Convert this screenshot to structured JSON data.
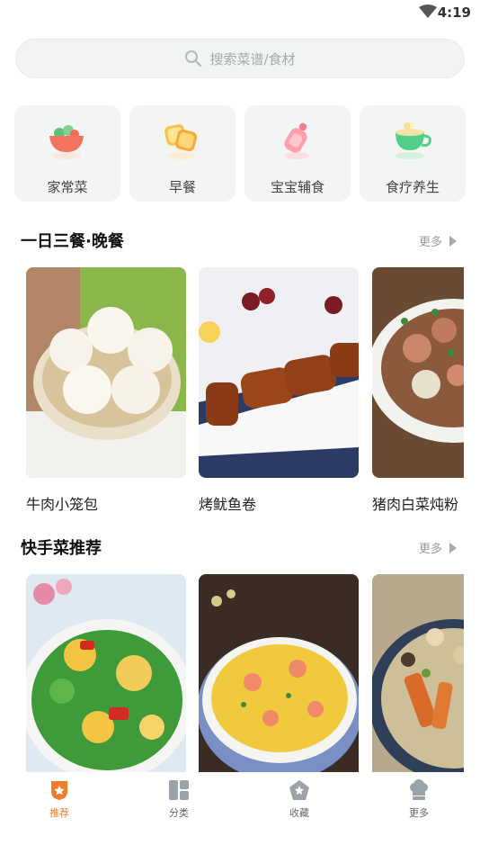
{
  "status": {
    "time": "4:19"
  },
  "search": {
    "placeholder": "搜索菜谱/食材"
  },
  "categories": [
    {
      "label": "家常菜",
      "icon": "bowl-icon"
    },
    {
      "label": "早餐",
      "icon": "toast-icon"
    },
    {
      "label": "宝宝辅食",
      "icon": "baby-bottle-icon"
    },
    {
      "label": "食疗养生",
      "icon": "tea-cup-icon"
    }
  ],
  "sections": [
    {
      "title": "一日三餐·晚餐",
      "more": "更多",
      "items": [
        {
          "name": "牛肉小笼包"
        },
        {
          "name": "烤鱿鱼卷"
        },
        {
          "name": "猪肉白菜炖粉"
        }
      ]
    },
    {
      "title": "快手菜推荐",
      "more": "更多",
      "items": [
        {
          "name": ""
        },
        {
          "name": ""
        },
        {
          "name": ""
        }
      ]
    }
  ],
  "tabbar": [
    {
      "label": "推荐",
      "icon": "recommend-icon",
      "active": true
    },
    {
      "label": "分类",
      "icon": "category-icon",
      "active": false
    },
    {
      "label": "收藏",
      "icon": "favorite-icon",
      "active": false
    },
    {
      "label": "更多",
      "icon": "chef-hat-icon",
      "active": false
    }
  ],
  "colors": {
    "accent": "#ef7d2a",
    "inactive_icon": "#9aa3aa",
    "card_bg": "#f3f5f4"
  }
}
